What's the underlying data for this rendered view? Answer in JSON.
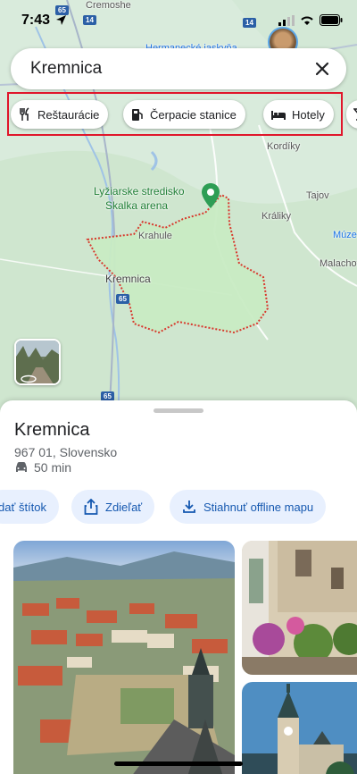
{
  "status": {
    "time": "7:43"
  },
  "search": {
    "query": "Kremnica"
  },
  "chips": [
    {
      "label": "Reštaurácie",
      "icon": "fork-knife-icon"
    },
    {
      "label": "Čerpacie stanice",
      "icon": "gas-station-icon"
    },
    {
      "label": "Hotely",
      "icon": "bed-icon"
    }
  ],
  "map": {
    "labels": {
      "cremoshe": "Cremoshe",
      "hermanecke": "Hermanecké jaskyňa",
      "kordiky": "Kordíky",
      "tajov": "Tajov",
      "kraliky": "Králiky",
      "muzeum": "Múze",
      "malachov": "Malachov",
      "skalka1": "Lyžiarske stredisko",
      "skalka2": "Skalka arena",
      "krahule": "Krahule",
      "kremnica": "Kremnica"
    },
    "routes": [
      "65",
      "14",
      "14",
      "65",
      "65"
    ]
  },
  "place": {
    "title": "Kremnica",
    "address": "967 01, Slovensko",
    "travel_time": "50 min"
  },
  "actions": [
    {
      "label": "dať štítok",
      "icon": "label-icon"
    },
    {
      "label": "Zdieľať",
      "icon": "share-icon"
    },
    {
      "label": "Stiahnuť offline mapu",
      "icon": "download-icon"
    }
  ],
  "colors": {
    "accent": "#1a73e8",
    "highlight": "#e0162b",
    "area_fill": "#c9ecc4",
    "boundary": "#d93025"
  }
}
